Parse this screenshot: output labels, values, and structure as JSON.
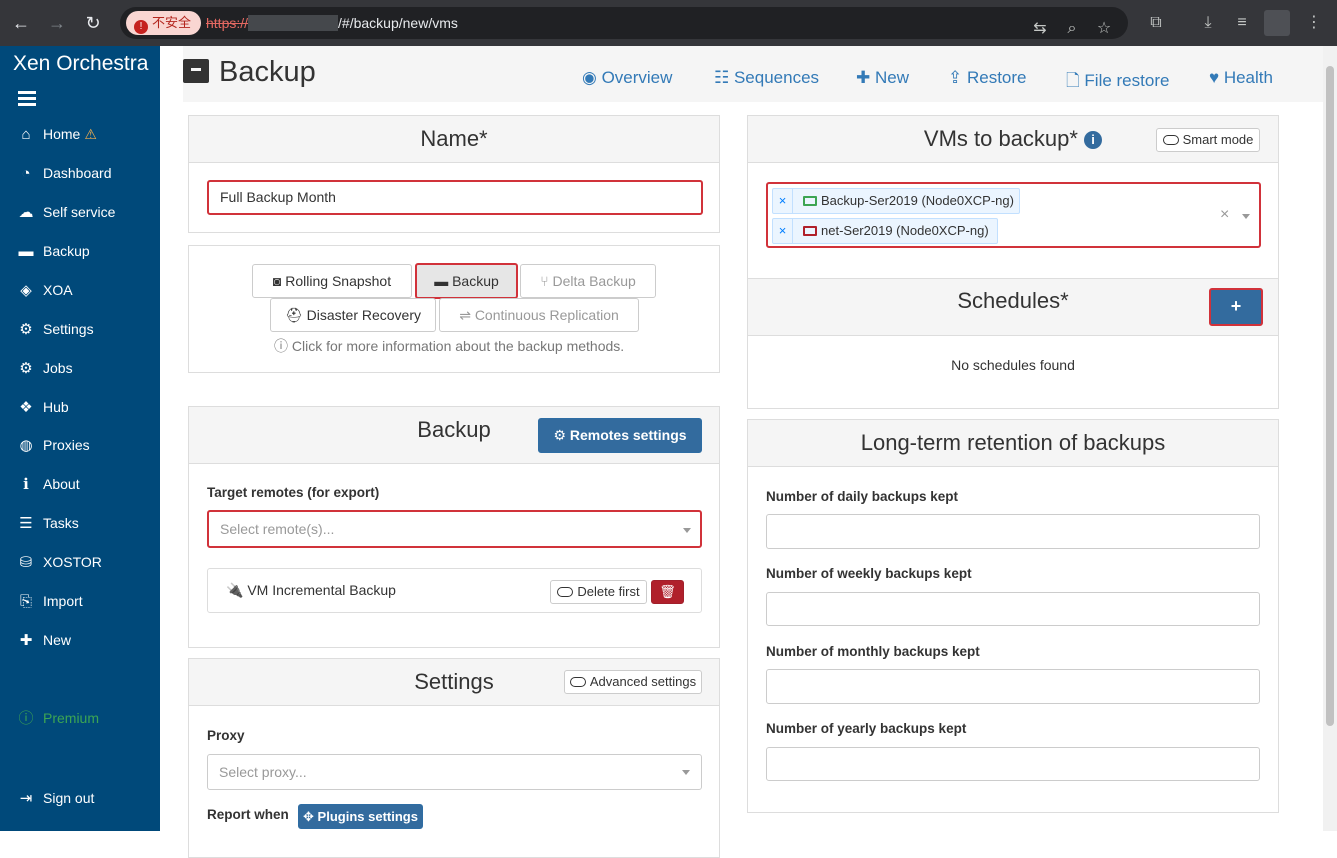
{
  "browser": {
    "insecure_label": "不安全",
    "url_proto": "https://",
    "url_path": "/#/backup/new/vms"
  },
  "sidebar": {
    "brand": "Xen Orchestra",
    "items": [
      {
        "label": "Home",
        "icon": "home-icon"
      },
      {
        "label": "Dashboard",
        "icon": "dashboard-icon"
      },
      {
        "label": "Self service",
        "icon": "cloud-icon"
      },
      {
        "label": "Backup",
        "icon": "archive-icon"
      },
      {
        "label": "XOA",
        "icon": "cube-icon"
      },
      {
        "label": "Settings",
        "icon": "gear-icon"
      },
      {
        "label": "Jobs",
        "icon": "gears-icon"
      },
      {
        "label": "Hub",
        "icon": "cubes-icon"
      },
      {
        "label": "Proxies",
        "icon": "globe-icon"
      },
      {
        "label": "About",
        "icon": "info-icon"
      },
      {
        "label": "Tasks",
        "icon": "tasks-icon"
      },
      {
        "label": "XOSTOR",
        "icon": "database-icon"
      },
      {
        "label": "Import",
        "icon": "file-import-icon"
      },
      {
        "label": "New",
        "icon": "plus-icon"
      }
    ],
    "premium": "Premium",
    "sign_out": "Sign out"
  },
  "header": {
    "title": "Backup",
    "tabs": [
      "Overview",
      "Sequences",
      "New",
      "Restore",
      "File restore",
      "Health"
    ]
  },
  "name_panel": {
    "title": "Name*",
    "value": "Full Backup Month"
  },
  "modes": {
    "rolling_snapshot": "Rolling Snapshot",
    "backup": "Backup",
    "delta_backup": "Delta Backup",
    "disaster_recovery": "Disaster Recovery",
    "continuous_replication": "Continuous Replication",
    "hint": "Click for more information about the backup methods."
  },
  "backup_panel": {
    "title": "Backup",
    "remotes_settings": "Remotes settings",
    "target_label": "Target remotes (for export)",
    "target_placeholder": "Select remote(s)...",
    "incremental_label": "VM Incremental Backup",
    "delete_first": "Delete first"
  },
  "settings_panel": {
    "title": "Settings",
    "advanced": "Advanced settings",
    "proxy_label": "Proxy",
    "proxy_placeholder": "Select proxy...",
    "report_label": "Report when",
    "plugins_settings": "Plugins settings"
  },
  "vms_panel": {
    "title": "VMs to backup*",
    "smart_mode": "Smart mode",
    "vms": [
      {
        "name": "Backup-Ser2019 (Node0XCP-ng)",
        "status": "running",
        "color": "#3ca553"
      },
      {
        "name": "net-Ser2019 (Node0XCP-ng)",
        "status": "halted",
        "color": "#b0202b"
      }
    ]
  },
  "schedules_panel": {
    "title": "Schedules*",
    "add_label": "+",
    "empty": "No schedules found"
  },
  "retention_panel": {
    "title": "Long-term retention of backups",
    "daily": "Number of daily backups kept",
    "weekly": "Number of weekly backups kept",
    "monthly": "Number of monthly backups kept",
    "yearly": "Number of yearly backups kept"
  }
}
